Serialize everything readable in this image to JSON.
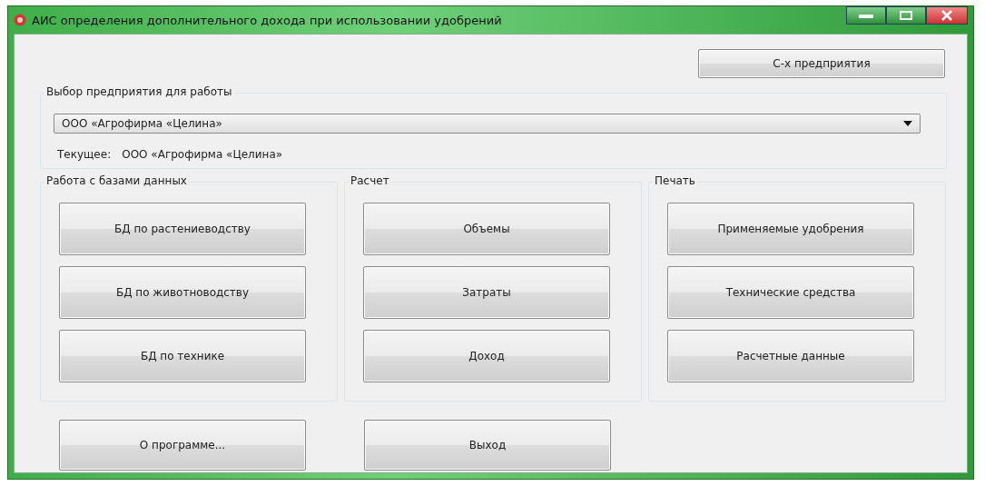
{
  "window": {
    "title": "АИС определения дополнительного дохода при использовании удобрений"
  },
  "top_button": "С-х предприятия",
  "enterprise": {
    "title": "Выбор предприятия для работы",
    "combo_value": "ООО «Агрофирма «Целина»",
    "current_label": "Текущее:",
    "current_value": "ООО «Агрофирма «Целина»"
  },
  "groups": [
    {
      "title": "Работа с базами данных",
      "buttons": [
        "БД по растениеводству",
        "БД по животноводству",
        "БД по технике"
      ]
    },
    {
      "title": "Расчет",
      "buttons": [
        "Объемы",
        "Затраты",
        "Доход"
      ]
    },
    {
      "title": "Печать",
      "buttons": [
        "Применяемые удобрения",
        "Технические средства",
        "Расчетные данные"
      ]
    }
  ],
  "bottom_buttons": [
    "О программе...",
    "Выход"
  ]
}
